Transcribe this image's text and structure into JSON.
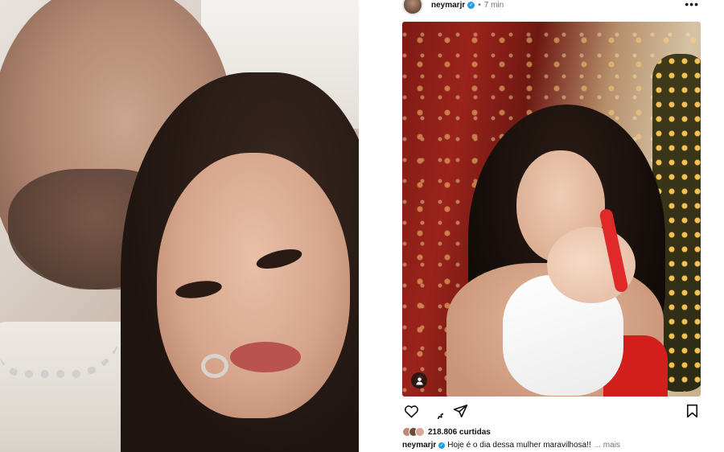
{
  "post": {
    "username": "neymarjr",
    "separator": "•",
    "time": "7 min",
    "more_icon": "more-horizontal-icon",
    "verified_icon": "verified-check-icon",
    "likes": "218.806 curtidas",
    "caption_username": "neymarjr",
    "caption_text": "Hoje é o dia dessa mulher maravilhosa!!",
    "caption_more": "... mais",
    "actions": [
      "heart-icon",
      "comment-icon",
      "share-icon",
      "bookmark-icon"
    ]
  },
  "colors": {
    "verified": "#1d9bf0",
    "text": "#111111",
    "secondary_text": "#737373"
  }
}
